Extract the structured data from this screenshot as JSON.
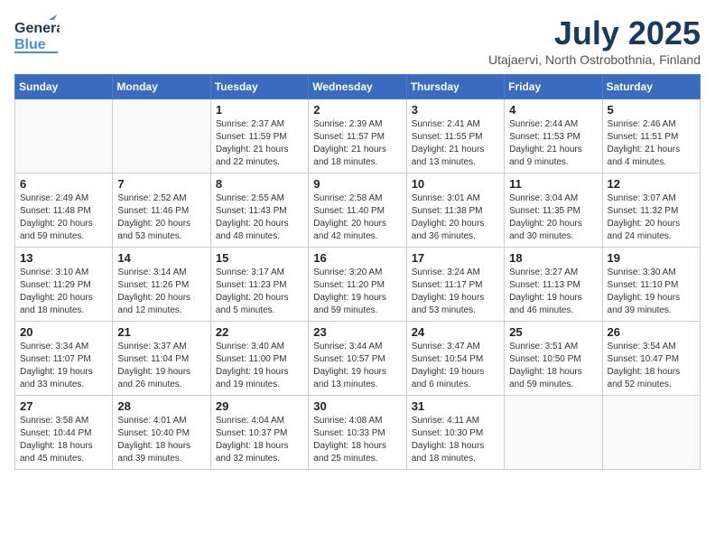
{
  "header": {
    "logo_line1": "General",
    "logo_line2": "Blue",
    "month": "July 2025",
    "location": "Utajaervi, North Ostrobothnia, Finland"
  },
  "weekdays": [
    "Sunday",
    "Monday",
    "Tuesday",
    "Wednesday",
    "Thursday",
    "Friday",
    "Saturday"
  ],
  "weeks": [
    [
      {
        "day": "",
        "info": ""
      },
      {
        "day": "",
        "info": ""
      },
      {
        "day": "1",
        "info": "Sunrise: 2:37 AM\nSunset: 11:59 PM\nDaylight: 21 hours and 22 minutes."
      },
      {
        "day": "2",
        "info": "Sunrise: 2:39 AM\nSunset: 11:57 PM\nDaylight: 21 hours and 18 minutes."
      },
      {
        "day": "3",
        "info": "Sunrise: 2:41 AM\nSunset: 11:55 PM\nDaylight: 21 hours and 13 minutes."
      },
      {
        "day": "4",
        "info": "Sunrise: 2:44 AM\nSunset: 11:53 PM\nDaylight: 21 hours and 9 minutes."
      },
      {
        "day": "5",
        "info": "Sunrise: 2:46 AM\nSunset: 11:51 PM\nDaylight: 21 hours and 4 minutes."
      }
    ],
    [
      {
        "day": "6",
        "info": "Sunrise: 2:49 AM\nSunset: 11:48 PM\nDaylight: 20 hours and 59 minutes."
      },
      {
        "day": "7",
        "info": "Sunrise: 2:52 AM\nSunset: 11:46 PM\nDaylight: 20 hours and 53 minutes."
      },
      {
        "day": "8",
        "info": "Sunrise: 2:55 AM\nSunset: 11:43 PM\nDaylight: 20 hours and 48 minutes."
      },
      {
        "day": "9",
        "info": "Sunrise: 2:58 AM\nSunset: 11:40 PM\nDaylight: 20 hours and 42 minutes."
      },
      {
        "day": "10",
        "info": "Sunrise: 3:01 AM\nSunset: 11:38 PM\nDaylight: 20 hours and 36 minutes."
      },
      {
        "day": "11",
        "info": "Sunrise: 3:04 AM\nSunset: 11:35 PM\nDaylight: 20 hours and 30 minutes."
      },
      {
        "day": "12",
        "info": "Sunrise: 3:07 AM\nSunset: 11:32 PM\nDaylight: 20 hours and 24 minutes."
      }
    ],
    [
      {
        "day": "13",
        "info": "Sunrise: 3:10 AM\nSunset: 11:29 PM\nDaylight: 20 hours and 18 minutes."
      },
      {
        "day": "14",
        "info": "Sunrise: 3:14 AM\nSunset: 11:26 PM\nDaylight: 20 hours and 12 minutes."
      },
      {
        "day": "15",
        "info": "Sunrise: 3:17 AM\nSunset: 11:23 PM\nDaylight: 20 hours and 5 minutes."
      },
      {
        "day": "16",
        "info": "Sunrise: 3:20 AM\nSunset: 11:20 PM\nDaylight: 19 hours and 59 minutes."
      },
      {
        "day": "17",
        "info": "Sunrise: 3:24 AM\nSunset: 11:17 PM\nDaylight: 19 hours and 53 minutes."
      },
      {
        "day": "18",
        "info": "Sunrise: 3:27 AM\nSunset: 11:13 PM\nDaylight: 19 hours and 46 minutes."
      },
      {
        "day": "19",
        "info": "Sunrise: 3:30 AM\nSunset: 11:10 PM\nDaylight: 19 hours and 39 minutes."
      }
    ],
    [
      {
        "day": "20",
        "info": "Sunrise: 3:34 AM\nSunset: 11:07 PM\nDaylight: 19 hours and 33 minutes."
      },
      {
        "day": "21",
        "info": "Sunrise: 3:37 AM\nSunset: 11:04 PM\nDaylight: 19 hours and 26 minutes."
      },
      {
        "day": "22",
        "info": "Sunrise: 3:40 AM\nSunset: 11:00 PM\nDaylight: 19 hours and 19 minutes."
      },
      {
        "day": "23",
        "info": "Sunrise: 3:44 AM\nSunset: 10:57 PM\nDaylight: 19 hours and 13 minutes."
      },
      {
        "day": "24",
        "info": "Sunrise: 3:47 AM\nSunset: 10:54 PM\nDaylight: 19 hours and 6 minutes."
      },
      {
        "day": "25",
        "info": "Sunrise: 3:51 AM\nSunset: 10:50 PM\nDaylight: 18 hours and 59 minutes."
      },
      {
        "day": "26",
        "info": "Sunrise: 3:54 AM\nSunset: 10:47 PM\nDaylight: 18 hours and 52 minutes."
      }
    ],
    [
      {
        "day": "27",
        "info": "Sunrise: 3:58 AM\nSunset: 10:44 PM\nDaylight: 18 hours and 45 minutes."
      },
      {
        "day": "28",
        "info": "Sunrise: 4:01 AM\nSunset: 10:40 PM\nDaylight: 18 hours and 39 minutes."
      },
      {
        "day": "29",
        "info": "Sunrise: 4:04 AM\nSunset: 10:37 PM\nDaylight: 18 hours and 32 minutes."
      },
      {
        "day": "30",
        "info": "Sunrise: 4:08 AM\nSunset: 10:33 PM\nDaylight: 18 hours and 25 minutes."
      },
      {
        "day": "31",
        "info": "Sunrise: 4:11 AM\nSunset: 10:30 PM\nDaylight: 18 hours and 18 minutes."
      },
      {
        "day": "",
        "info": ""
      },
      {
        "day": "",
        "info": ""
      }
    ]
  ]
}
